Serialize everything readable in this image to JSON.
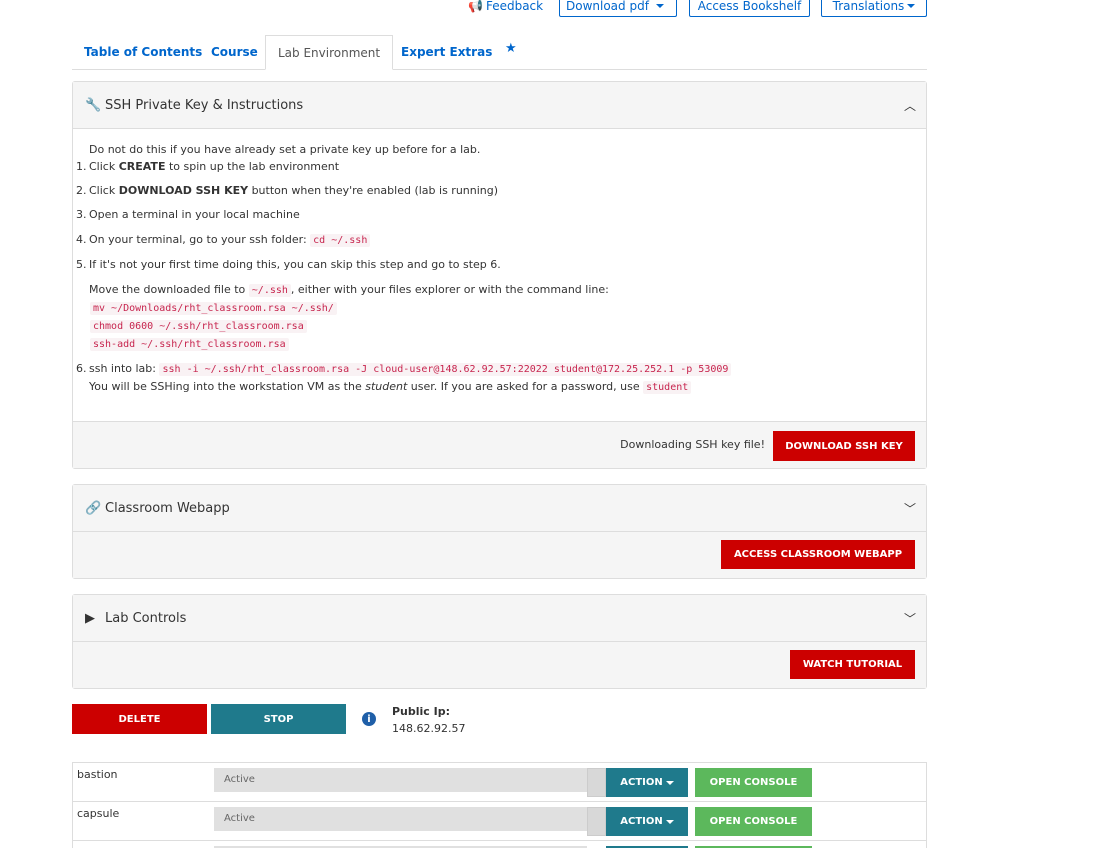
{
  "toolbar": {
    "feedback": "Feedback",
    "download_pdf": "Download pdf",
    "access_bookshelf": "Access Bookshelf",
    "translations": "Translations"
  },
  "tabs": {
    "toc": "Table of Contents",
    "course": "Course",
    "lab_env": "Lab Environment",
    "expert_extras": "Expert Extras",
    "star": "★"
  },
  "ssh_panel": {
    "title": "SSH Private Key & Instructions",
    "intro": "Do not do this if you have already set a private key up before for a lab.",
    "step1_a": "Click ",
    "step1_b": "CREATE",
    "step1_c": " to spin up the lab environment",
    "step2_a": "Click ",
    "step2_b": "DOWNLOAD SSH KEY",
    "step2_c": " button when they're enabled (lab is running)",
    "step3": "Open a terminal in your local machine",
    "step4_a": "On your terminal, go to your ssh folder: ",
    "step4_code": "cd ~/.ssh",
    "step5": "If it's not your first time doing this, you can skip this step and go to step 6.",
    "move_a": "Move the downloaded file to ",
    "move_code": "~/.ssh",
    "move_b": ", either with your files explorer or with the command line:",
    "cmd1": "mv ~/Downloads/rht_classroom.rsa ~/.ssh/",
    "cmd2": "chmod 0600 ~/.ssh/rht_classroom.rsa",
    "cmd3": "ssh-add ~/.ssh/rht_classroom.rsa",
    "step6_a": "ssh into lab: ",
    "step6_code": "ssh -i ~/.ssh/rht_classroom.rsa -J cloud-user@148.62.92.57:22022 student@172.25.252.1 -p 53009",
    "ssh_note_a": "You will be SSHing into the workstation VM as the ",
    "ssh_note_user": "student",
    "ssh_note_b": " user. If you are asked for a password, use ",
    "ssh_note_pw": "student",
    "downloading": "Downloading SSH key file!",
    "download_btn": "DOWNLOAD SSH KEY",
    "nums": [
      "1.",
      "2.",
      "3.",
      "4.",
      "5.",
      "6."
    ]
  },
  "webapp_panel": {
    "title": "Classroom Webapp",
    "button": "ACCESS CLASSROOM WEBAPP"
  },
  "lab_controls": {
    "title": "Lab Controls",
    "button": "WATCH TUTORIAL"
  },
  "controls": {
    "delete": "DELETE",
    "stop": "STOP",
    "info": "i",
    "public_ip_label": "Public Ip:",
    "public_ip": "148.62.92.57"
  },
  "vms": [
    {
      "name": "bastion",
      "status": "Active",
      "action": "ACTION",
      "console": "OPEN CONSOLE"
    },
    {
      "name": "capsule",
      "status": "Active",
      "action": "ACTION",
      "console": "OPEN CONSOLE"
    }
  ],
  "colors": {
    "link": "#0066cc",
    "danger": "#cc0000",
    "teal": "#1f7a8c",
    "success": "#5cb85c"
  }
}
